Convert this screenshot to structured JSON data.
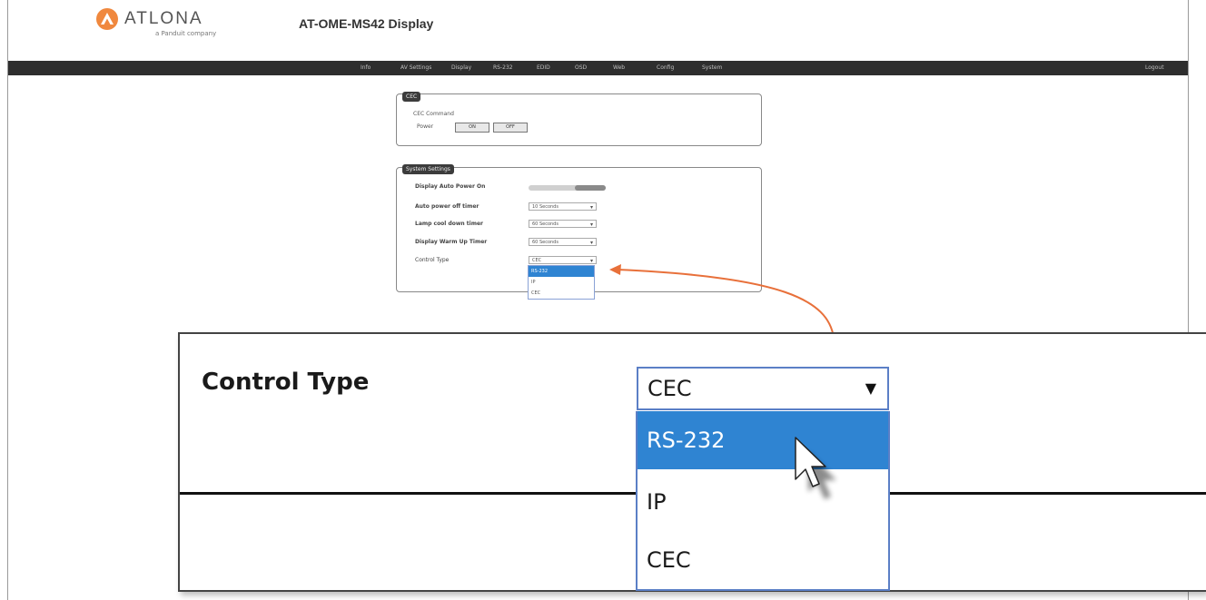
{
  "header": {
    "brand": "ATLONA",
    "brand_sub": "a Panduit company",
    "device_title": "AT-OME-MS42  Display"
  },
  "nav": {
    "items": [
      "Info",
      "AV Settings",
      "Display",
      "RS-232",
      "EDID",
      "OSD",
      "Web",
      "Config",
      "System"
    ],
    "logout": "Logout"
  },
  "cec_panel": {
    "legend": "CEC",
    "command_label": "CEC Command",
    "power_label": "Power",
    "on_label": "ON",
    "off_label": "OFF"
  },
  "system_panel": {
    "legend": "System Settings",
    "rows": [
      {
        "label": "Display Auto Power On",
        "value": ""
      },
      {
        "label": "Auto power off timer",
        "value": "10 Seconds"
      },
      {
        "label": "Lamp cool down timer",
        "value": "60 Seconds"
      },
      {
        "label": "Display Warm Up Timer",
        "value": "60 Seconds"
      },
      {
        "label": "Control Type",
        "value": "CEC"
      }
    ],
    "dropdown_options": [
      "RS-232",
      "IP",
      "CEC"
    ]
  },
  "zoom": {
    "label": "Control Type",
    "selected": "CEC",
    "options": [
      "RS-232",
      "IP",
      "CEC"
    ],
    "highlighted": "RS-232"
  },
  "colors": {
    "accent_arrow": "#e8703a",
    "highlight": "#2f84d2",
    "navbar": "#2e2e2e"
  }
}
